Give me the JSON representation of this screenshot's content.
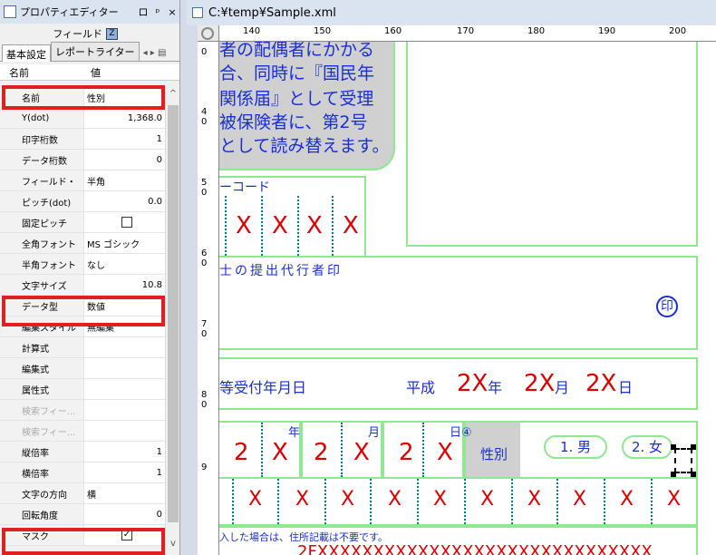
{
  "panel": {
    "title": "プロパティエディター",
    "buttons": [
      "ロ",
      "ᵖ",
      "×"
    ],
    "field_label": "フィールド",
    "field_icon": "Z",
    "tabs": [
      "基本設定",
      "レポートライター"
    ],
    "tab_nav": "◂ ▸ ▤",
    "col_name": "名前",
    "col_value": "値",
    "rows": [
      {
        "name": "名前",
        "value": "性別"
      },
      {
        "name": "Y(dot)",
        "value": "1,368.0"
      },
      {
        "name": "印字桁数",
        "value": "1"
      },
      {
        "name": "データ桁数",
        "value": "0"
      },
      {
        "name": "フィールド・",
        "value": "半角"
      },
      {
        "name": "ピッチ(dot)",
        "value": "0.0"
      },
      {
        "name": "固定ピッチ",
        "value": ""
      },
      {
        "name": "全角フォント",
        "value": "MS ゴシック"
      },
      {
        "name": "半角フォント",
        "value": "なし"
      },
      {
        "name": "文字サイズ",
        "value": "10.8"
      },
      {
        "name": "データ型",
        "value": "数値"
      },
      {
        "name": "編集スタイル",
        "value": "無編集"
      },
      {
        "name": "計算式",
        "value": ""
      },
      {
        "name": "編集式",
        "value": ""
      },
      {
        "name": "属性式",
        "value": ""
      },
      {
        "name": "検索フィー...",
        "value": ""
      },
      {
        "name": "検索フィー...",
        "value": ""
      },
      {
        "name": "縦倍率",
        "value": "1"
      },
      {
        "name": "横倍率",
        "value": "1"
      },
      {
        "name": "文字の方向",
        "value": "横"
      },
      {
        "name": "回転角度",
        "value": "0"
      },
      {
        "name": "マスク",
        "value": "✓"
      }
    ]
  },
  "main": {
    "title": "C:¥temp¥Sample.xml",
    "ruler_labels": [
      "140",
      "150",
      "160",
      "170",
      "180",
      "190",
      "200"
    ],
    "vruler_labels": [
      "0",
      "4\n0",
      "5\n0",
      "6\n0",
      "7\n0",
      "8\n0",
      "9"
    ],
    "note_lines": [
      "者の配偶者にかかる",
      "合、同時に『国民年",
      "関係届』として受理",
      "被保険者に、第2号",
      "として読み替えます。"
    ],
    "code_label": "ーコード",
    "agent_label": "士の提出代行者印",
    "seal": "印",
    "date_label": "等受付年月日",
    "era": "平成",
    "date_xs": [
      "2X",
      "2X",
      "2X"
    ],
    "date_units": [
      "年",
      "月",
      "日"
    ],
    "birth_marks": [
      "年",
      "月",
      "日④"
    ],
    "birth_vals": [
      "2",
      "X",
      "2",
      "X",
      "2",
      "X"
    ],
    "sex_label": "性別",
    "male": "1. 男",
    "female": "2. 女",
    "x_mark": "X",
    "bottom_note": "入した場合は、住所記載は不要です。",
    "bottom_red": "2FXXXXXXXXXXXXXXXXXXXXXXXXXXXXXX"
  }
}
